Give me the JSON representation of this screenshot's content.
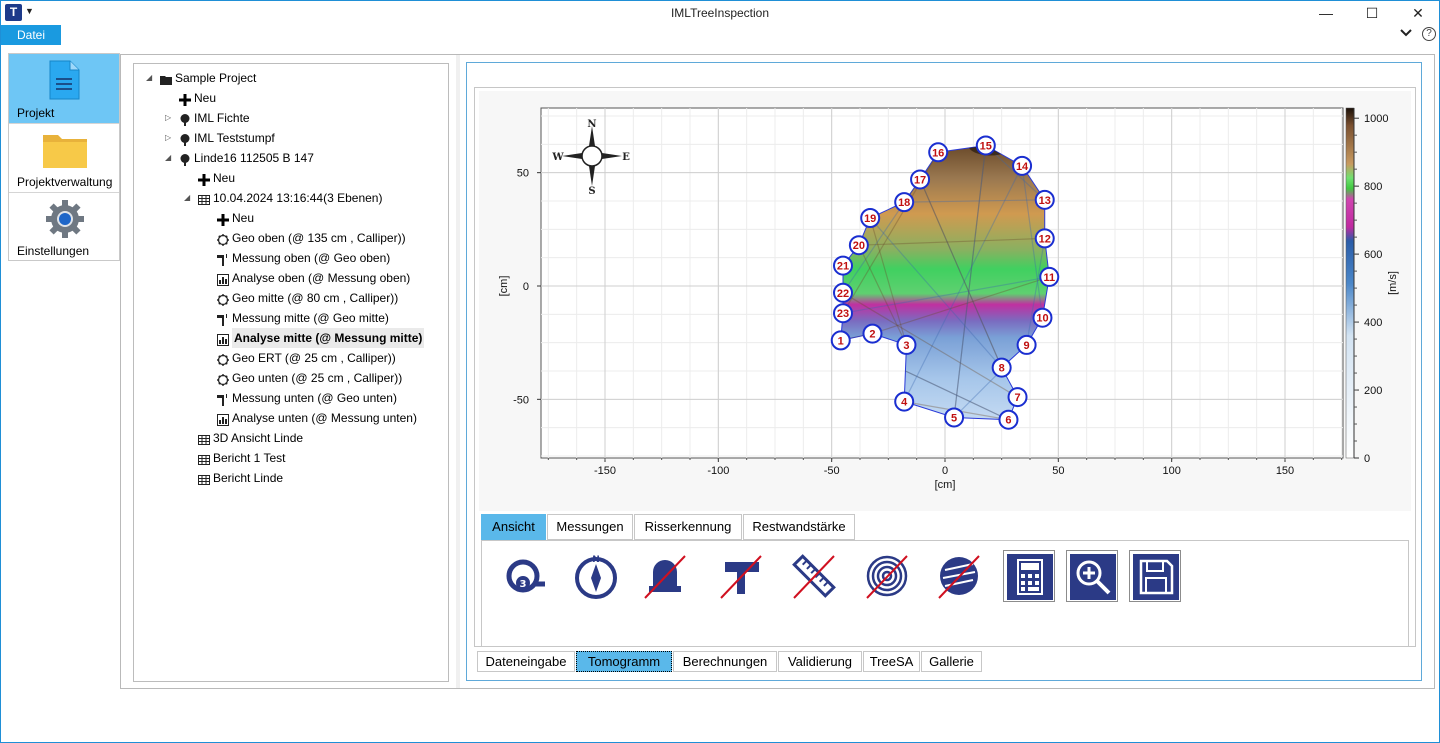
{
  "window": {
    "title": "IMLTreeInspection",
    "app_icon_letter": "T",
    "min": "—",
    "max": "☐",
    "close": "✕"
  },
  "menu": {
    "datei": "Datei",
    "collapse": "⌄",
    "help": "?"
  },
  "nav": {
    "items": [
      {
        "label": "Projekt",
        "icon": "document-icon"
      },
      {
        "label": "Projektverwaltung",
        "icon": "folder-icon"
      },
      {
        "label": "Einstellungen",
        "icon": "gear-icon"
      }
    ]
  },
  "tree": {
    "nodes": [
      {
        "label": "Sample Project",
        "level": 0,
        "expander": "◢",
        "icon": "folder-icon"
      },
      {
        "label": "Neu",
        "level": 1,
        "icon": "plus-icon"
      },
      {
        "label": "IML Fichte",
        "level": 1,
        "expander": "▷",
        "icon": "tree-icon"
      },
      {
        "label": "IML Teststumpf",
        "level": 1,
        "expander": "▷",
        "icon": "tree-icon"
      },
      {
        "label": "Linde16 112505 B 147",
        "level": 1,
        "expander": "◢",
        "icon": "tree-icon"
      },
      {
        "label": "Neu",
        "level": 2,
        "icon": "plus-icon"
      },
      {
        "label": "10.04.2024 13:16:44(3 Ebenen)",
        "level": 2,
        "expander": "◢",
        "icon": "table-icon"
      },
      {
        "label": "Neu",
        "level": 3,
        "icon": "plus-icon"
      },
      {
        "label": "Geo oben (@ 135 cm , Calliper))",
        "level": 3,
        "icon": "geo-icon"
      },
      {
        "label": "Messung oben (@ Geo oben)",
        "level": 3,
        "icon": "hammer-icon"
      },
      {
        "label": "Analyse oben (@ Messung oben)",
        "level": 3,
        "icon": "chart-icon"
      },
      {
        "label": "Geo mitte (@ 80 cm , Calliper))",
        "level": 3,
        "icon": "geo-icon"
      },
      {
        "label": "Messung mitte (@ Geo mitte)",
        "level": 3,
        "icon": "hammer-icon"
      },
      {
        "label": "Analyse mitte (@ Messung mitte)",
        "level": 3,
        "icon": "chart-icon",
        "selected": true
      },
      {
        "label": "Geo ERT (@ 25 cm , Calliper))",
        "level": 3,
        "icon": "geo-icon"
      },
      {
        "label": "Geo unten (@ 25 cm , Calliper))",
        "level": 3,
        "icon": "geo-icon"
      },
      {
        "label": "Messung unten (@ Geo unten)",
        "level": 3,
        "icon": "hammer-icon"
      },
      {
        "label": "Analyse unten (@ Messung unten)",
        "level": 3,
        "icon": "chart-icon"
      },
      {
        "label": "3D Ansicht Linde",
        "level": 2,
        "icon": "table-icon"
      },
      {
        "label": "Bericht 1 Test",
        "level": 2,
        "icon": "table-icon"
      },
      {
        "label": "Bericht Linde",
        "level": 2,
        "icon": "table-icon"
      }
    ]
  },
  "plot": {
    "x_ticks": [
      "-150",
      "-100",
      "-50",
      "0",
      "50",
      "100",
      "150"
    ],
    "y_ticks": [
      "50",
      "0",
      "-50"
    ],
    "x_label": "[cm]",
    "y_label": "[cm]",
    "colorbar_ticks": [
      "1000",
      "800",
      "600",
      "400",
      "200",
      "0"
    ],
    "colorbar_label": "[m/s]",
    "compass": {
      "n": "N",
      "s": "S",
      "w": "W",
      "e": "E"
    },
    "sensors": [
      "1",
      "2",
      "3",
      "4",
      "5",
      "6",
      "7",
      "8",
      "9",
      "10",
      "11",
      "12",
      "13",
      "14",
      "15",
      "16",
      "17",
      "18",
      "19",
      "20",
      "21",
      "22",
      "23"
    ]
  },
  "ribbon_tabs": [
    "Ansicht",
    "Messungen",
    "Risserkennung",
    "Restwandstärke"
  ],
  "tools": [
    {
      "name": "sensor-count-3-icon",
      "badge": "3"
    },
    {
      "name": "compass-north-icon",
      "badge": "N"
    },
    {
      "name": "bell-crossed-icon"
    },
    {
      "name": "hammer-crossed-icon"
    },
    {
      "name": "ruler-crossed-icon"
    },
    {
      "name": "rings-crossed-icon"
    },
    {
      "name": "crack-crossed-icon"
    },
    {
      "name": "calculator-icon"
    },
    {
      "name": "zoom-in-icon"
    },
    {
      "name": "save-icon"
    }
  ],
  "bottom_tabs": [
    "Dateneingabe",
    "Tomogramm",
    "Berechnungen",
    "Validierung",
    "TreeSA",
    "Gallerie"
  ],
  "colors": {
    "accent": "#1a9ae0",
    "selected_tab": "#5ab8ea",
    "nav_selected": "#6ec6f5",
    "sensor": "#1a2ed0",
    "sensor_text": "#c01010",
    "tool_icon": "#2b3a86",
    "cross": "#d01020"
  }
}
